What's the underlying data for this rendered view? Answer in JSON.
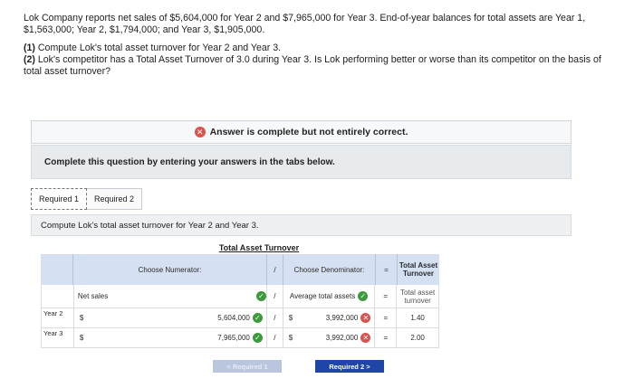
{
  "problem": {
    "statement": "Lok Company reports net sales of $5,604,000 for Year 2 and $7,965,000 for Year 3. End-of-year balances for total assets are Year 1, $1,563,000; Year 2, $1,794,000; and Year 3, $1,905,000.",
    "q1_tag": "(1)",
    "q1_text": " Compute Lok's total asset turnover for Year 2 and Year 3.",
    "q2_tag": "(2)",
    "q2_text": " Lok's competitor has a Total Asset Turnover of 3.0 during Year 3. Is Lok performing better or worse than its competitor on the basis of total asset turnover?"
  },
  "banner": {
    "text": "Answer is complete but not entirely correct."
  },
  "instructions": {
    "text": "Complete this question by entering your answers in the tabs below."
  },
  "tabs": [
    {
      "label": "Required 1"
    },
    {
      "label": "Required 2"
    }
  ],
  "subtask": {
    "text": "Compute Lok's total asset turnover for Year 2 and Year 3."
  },
  "table": {
    "title": "Total Asset Turnover",
    "headers": {
      "numerator": "Choose Numerator:",
      "slash": "/",
      "denominator": "Choose Denominator:",
      "equals": "=",
      "result": "Total Asset Turnover"
    },
    "label_row": {
      "numerator": "Net sales",
      "slash": "/",
      "denominator": "Average total assets",
      "equals": "=",
      "result": "Total asset turnover"
    },
    "rows": [
      {
        "year": "Year 2",
        "dollar1": "$",
        "numerator": "5,604,000",
        "slash": "/",
        "dollar2": "$",
        "denominator": "3,992,000",
        "equals": "=",
        "result": "1.40"
      },
      {
        "year": "Year 3",
        "dollar1": "$",
        "numerator": "7,965,000",
        "slash": "/",
        "dollar2": "$",
        "denominator": "3,992,000",
        "equals": "=",
        "result": "2.00"
      }
    ]
  },
  "nav": {
    "prev": "< Required 1",
    "next": "Required 2  >"
  },
  "colors": {
    "header_bg": "#d5e1f2",
    "correct": "#3c9a3c",
    "incorrect": "#d9534f",
    "next_button": "#1f46a6"
  }
}
